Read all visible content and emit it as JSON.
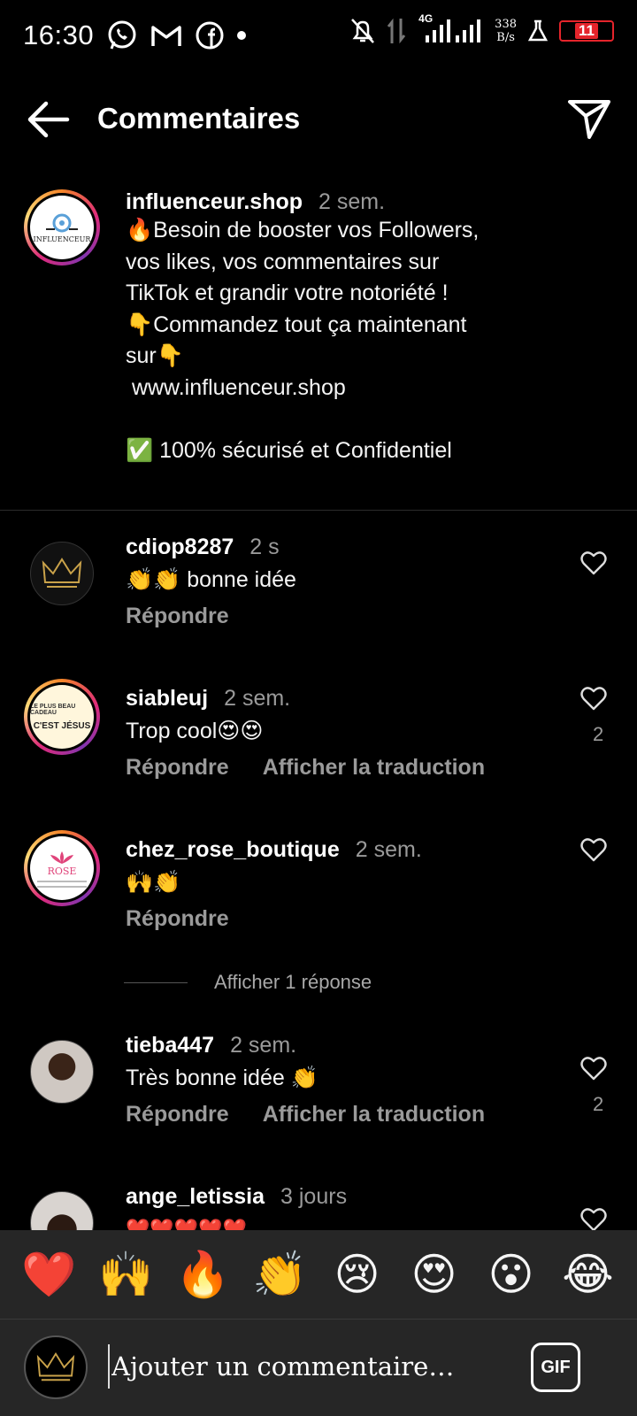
{
  "status_bar": {
    "time": "16:30",
    "network": "4G",
    "speed_value": "338",
    "speed_unit": "B/s",
    "battery": "11"
  },
  "header": {
    "title": "Commentaires"
  },
  "caption": {
    "username": "influenceur.shop",
    "time": "2 sem.",
    "text": "🔥Besoin de booster vos Followers,\nvos likes, vos commentaires sur\nTikTok et grandir votre notoriété !\n👇Commandez tout ça maintenant\nsur👇\n www.influenceur.shop\n\n✅ 100% sécurisé et Confidentiel",
    "avatar_text": "INFLUENCEUR"
  },
  "comments": [
    {
      "username": "cdiop8287",
      "time": "2 s",
      "text": "👏👏 bonne idée",
      "reply": "Répondre",
      "translate": "",
      "likes": ""
    },
    {
      "username": "siableuj",
      "time": "2 sem.",
      "text": "Trop cool😍😍",
      "reply": "Répondre",
      "translate": "Afficher la traduction",
      "likes": "2",
      "avatar_line1": "LE PLUS BEAU CADEAU",
      "avatar_line2": "C'EST JÉSUS"
    },
    {
      "username": "chez_rose_boutique",
      "time": "2 sem.",
      "text": "🙌👏",
      "reply": "Répondre",
      "translate": "",
      "likes": "",
      "avatar_line1": "ROSE"
    },
    {
      "username": "tieba447",
      "time": "2 sem.",
      "text": "Très bonne idée 👏",
      "reply": "Répondre",
      "translate": "Afficher la traduction",
      "likes": "2"
    },
    {
      "username": "ange_letissia",
      "time": "3 jours",
      "text": "❤️❤️❤️❤️❤️",
      "reply": "",
      "translate": "",
      "likes": ""
    }
  ],
  "view_replies": "Afficher 1 réponse",
  "emoji_bar": [
    "❤️",
    "🙌",
    "🔥",
    "👏",
    "😢",
    "😍",
    "😮",
    "😂"
  ],
  "input": {
    "placeholder": "Ajouter un commentaire…",
    "gif_label": "GIF"
  },
  "colors": {
    "background": "#000000",
    "secondary_text": "#9a9a9a",
    "bar_background": "#262626",
    "battery_low": "#e5242b"
  }
}
